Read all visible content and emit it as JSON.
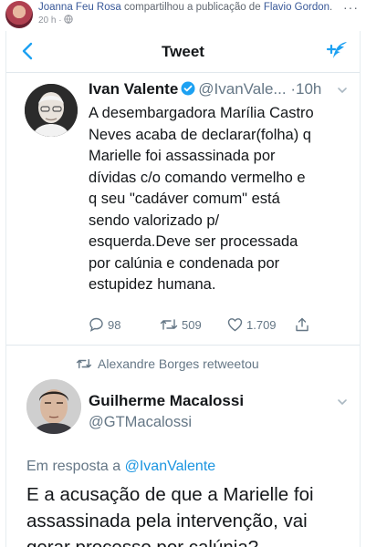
{
  "fb": {
    "sharer": "Joanna Feu Rosa",
    "action": "compartilhou a publicação de",
    "source": "Flavio Gordon",
    "time": "20 h",
    "separator": "·",
    "more": "···"
  },
  "nav": {
    "title": "Tweet"
  },
  "tweet": {
    "display_name": "Ivan Valente",
    "handle": "@IvanVale...",
    "time": "·10h",
    "lines": [
      "A desembargadora Marília Castro",
      "Neves acaba de declarar(folha) q",
      "Marielle foi assassinada por",
      "dívidas c/o comando vermelho e",
      "q seu \"cadáver comum\" está",
      "sendo valorizado p/",
      "esquerda.Deve ser processada",
      "por calúnia e condenada por",
      "estupidez humana."
    ],
    "replies": "98",
    "retweets": "509",
    "likes": "1.709"
  },
  "retweeted_by": "Alexandre Borges retweetou",
  "reply": {
    "display_name": "Guilherme Macalossi",
    "handle": "@GTMacalossi",
    "in_reply_prefix": "Em resposta a",
    "in_reply_handle": "@IvanValente",
    "lines": [
      "E a acusação de que a Marielle foi",
      "assassinada pela intervenção, vai",
      "gerar processo por calúnia?"
    ]
  },
  "colors": {
    "twitter_blue": "#1da1f2",
    "link_blue": "#1b95e0",
    "muted": "#657786",
    "fb_link": "#385898"
  }
}
